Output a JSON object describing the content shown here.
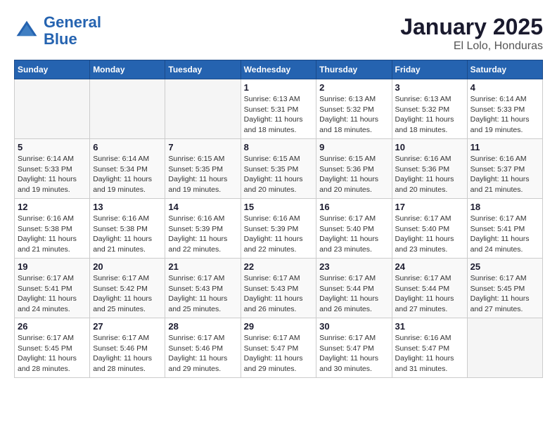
{
  "header": {
    "logo_line1": "General",
    "logo_line2": "Blue",
    "month_title": "January 2025",
    "location": "El Lolo, Honduras"
  },
  "days_of_week": [
    "Sunday",
    "Monday",
    "Tuesday",
    "Wednesday",
    "Thursday",
    "Friday",
    "Saturday"
  ],
  "weeks": [
    [
      {
        "day": "",
        "info": ""
      },
      {
        "day": "",
        "info": ""
      },
      {
        "day": "",
        "info": ""
      },
      {
        "day": "1",
        "info": "Sunrise: 6:13 AM\nSunset: 5:31 PM\nDaylight: 11 hours and 18 minutes."
      },
      {
        "day": "2",
        "info": "Sunrise: 6:13 AM\nSunset: 5:32 PM\nDaylight: 11 hours and 18 minutes."
      },
      {
        "day": "3",
        "info": "Sunrise: 6:13 AM\nSunset: 5:32 PM\nDaylight: 11 hours and 18 minutes."
      },
      {
        "day": "4",
        "info": "Sunrise: 6:14 AM\nSunset: 5:33 PM\nDaylight: 11 hours and 19 minutes."
      }
    ],
    [
      {
        "day": "5",
        "info": "Sunrise: 6:14 AM\nSunset: 5:33 PM\nDaylight: 11 hours and 19 minutes."
      },
      {
        "day": "6",
        "info": "Sunrise: 6:14 AM\nSunset: 5:34 PM\nDaylight: 11 hours and 19 minutes."
      },
      {
        "day": "7",
        "info": "Sunrise: 6:15 AM\nSunset: 5:35 PM\nDaylight: 11 hours and 19 minutes."
      },
      {
        "day": "8",
        "info": "Sunrise: 6:15 AM\nSunset: 5:35 PM\nDaylight: 11 hours and 20 minutes."
      },
      {
        "day": "9",
        "info": "Sunrise: 6:15 AM\nSunset: 5:36 PM\nDaylight: 11 hours and 20 minutes."
      },
      {
        "day": "10",
        "info": "Sunrise: 6:16 AM\nSunset: 5:36 PM\nDaylight: 11 hours and 20 minutes."
      },
      {
        "day": "11",
        "info": "Sunrise: 6:16 AM\nSunset: 5:37 PM\nDaylight: 11 hours and 21 minutes."
      }
    ],
    [
      {
        "day": "12",
        "info": "Sunrise: 6:16 AM\nSunset: 5:38 PM\nDaylight: 11 hours and 21 minutes."
      },
      {
        "day": "13",
        "info": "Sunrise: 6:16 AM\nSunset: 5:38 PM\nDaylight: 11 hours and 21 minutes."
      },
      {
        "day": "14",
        "info": "Sunrise: 6:16 AM\nSunset: 5:39 PM\nDaylight: 11 hours and 22 minutes."
      },
      {
        "day": "15",
        "info": "Sunrise: 6:16 AM\nSunset: 5:39 PM\nDaylight: 11 hours and 22 minutes."
      },
      {
        "day": "16",
        "info": "Sunrise: 6:17 AM\nSunset: 5:40 PM\nDaylight: 11 hours and 23 minutes."
      },
      {
        "day": "17",
        "info": "Sunrise: 6:17 AM\nSunset: 5:40 PM\nDaylight: 11 hours and 23 minutes."
      },
      {
        "day": "18",
        "info": "Sunrise: 6:17 AM\nSunset: 5:41 PM\nDaylight: 11 hours and 24 minutes."
      }
    ],
    [
      {
        "day": "19",
        "info": "Sunrise: 6:17 AM\nSunset: 5:41 PM\nDaylight: 11 hours and 24 minutes."
      },
      {
        "day": "20",
        "info": "Sunrise: 6:17 AM\nSunset: 5:42 PM\nDaylight: 11 hours and 25 minutes."
      },
      {
        "day": "21",
        "info": "Sunrise: 6:17 AM\nSunset: 5:43 PM\nDaylight: 11 hours and 25 minutes."
      },
      {
        "day": "22",
        "info": "Sunrise: 6:17 AM\nSunset: 5:43 PM\nDaylight: 11 hours and 26 minutes."
      },
      {
        "day": "23",
        "info": "Sunrise: 6:17 AM\nSunset: 5:44 PM\nDaylight: 11 hours and 26 minutes."
      },
      {
        "day": "24",
        "info": "Sunrise: 6:17 AM\nSunset: 5:44 PM\nDaylight: 11 hours and 27 minutes."
      },
      {
        "day": "25",
        "info": "Sunrise: 6:17 AM\nSunset: 5:45 PM\nDaylight: 11 hours and 27 minutes."
      }
    ],
    [
      {
        "day": "26",
        "info": "Sunrise: 6:17 AM\nSunset: 5:45 PM\nDaylight: 11 hours and 28 minutes."
      },
      {
        "day": "27",
        "info": "Sunrise: 6:17 AM\nSunset: 5:46 PM\nDaylight: 11 hours and 28 minutes."
      },
      {
        "day": "28",
        "info": "Sunrise: 6:17 AM\nSunset: 5:46 PM\nDaylight: 11 hours and 29 minutes."
      },
      {
        "day": "29",
        "info": "Sunrise: 6:17 AM\nSunset: 5:47 PM\nDaylight: 11 hours and 29 minutes."
      },
      {
        "day": "30",
        "info": "Sunrise: 6:17 AM\nSunset: 5:47 PM\nDaylight: 11 hours and 30 minutes."
      },
      {
        "day": "31",
        "info": "Sunrise: 6:16 AM\nSunset: 5:47 PM\nDaylight: 11 hours and 31 minutes."
      },
      {
        "day": "",
        "info": ""
      }
    ]
  ]
}
